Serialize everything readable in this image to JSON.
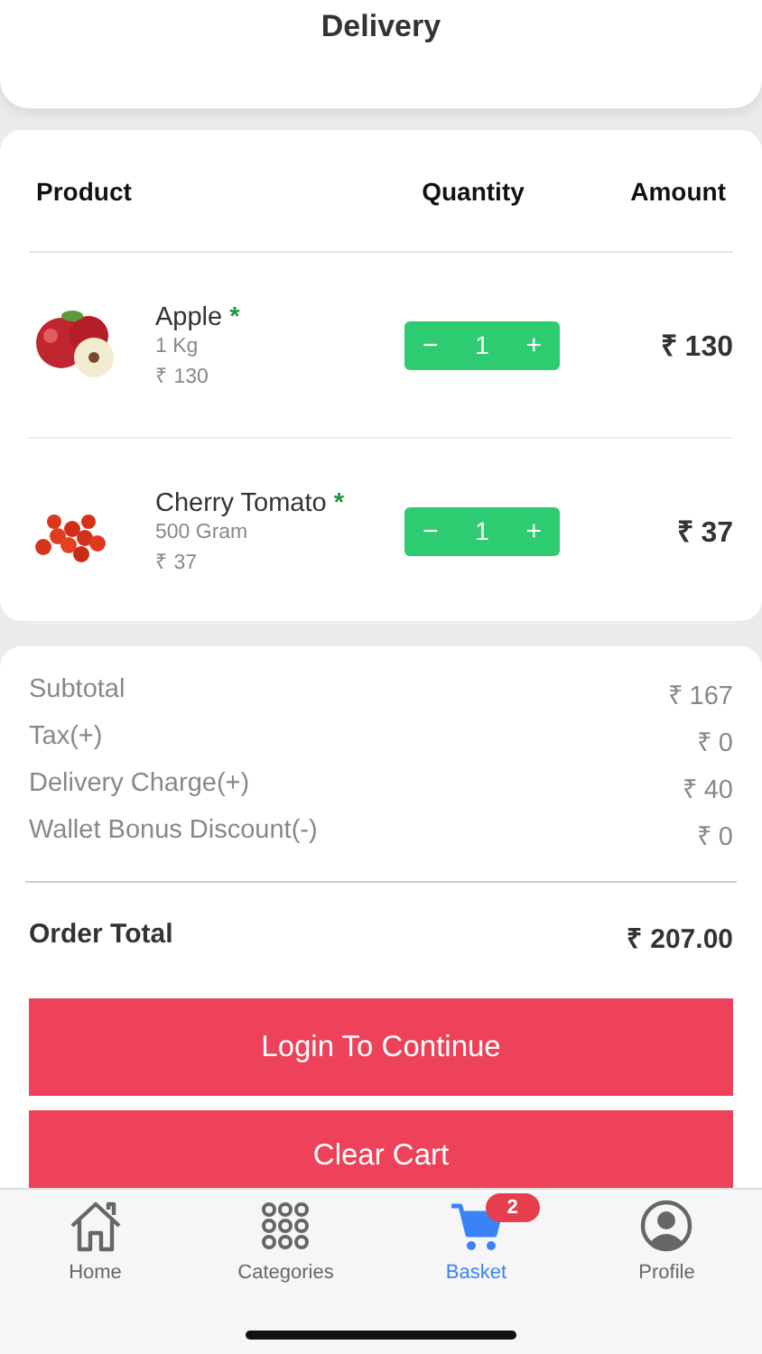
{
  "header": {
    "title": "Delivery"
  },
  "table": {
    "columns": [
      "Product",
      "Quantity",
      "Amount"
    ],
    "rows": [
      {
        "name": "Apple",
        "required_mark": "*",
        "unit": "1 Kg",
        "price": "₹ 130",
        "quantity": "1",
        "decrement": "−",
        "increment": "+",
        "amount": "₹ 130"
      },
      {
        "name": "Cherry Tomato",
        "required_mark": "*",
        "unit": "500 Gram",
        "price": "₹ 37",
        "quantity": "1",
        "decrement": "−",
        "increment": "+",
        "amount": "₹ 37"
      }
    ]
  },
  "summary": {
    "lines": [
      {
        "label": "Subtotal",
        "value": "₹ 167"
      },
      {
        "label": "Tax(+)",
        "value": "₹ 0"
      },
      {
        "label": "Delivery Charge(+)",
        "value": "₹ 40"
      },
      {
        "label": "Wallet Bonus Discount(-)",
        "value": "₹ 0"
      }
    ],
    "total": {
      "label": "Order Total",
      "value": "₹ 207.00"
    }
  },
  "buttons": [
    "Login To Continue",
    "Clear Cart"
  ],
  "tab_bar": [
    {
      "label": "Home",
      "selected": false
    },
    {
      "label": "Categories",
      "selected": false
    },
    {
      "label": "Basket",
      "selected": true,
      "badge": "2"
    },
    {
      "label": "Profile",
      "selected": false
    }
  ]
}
